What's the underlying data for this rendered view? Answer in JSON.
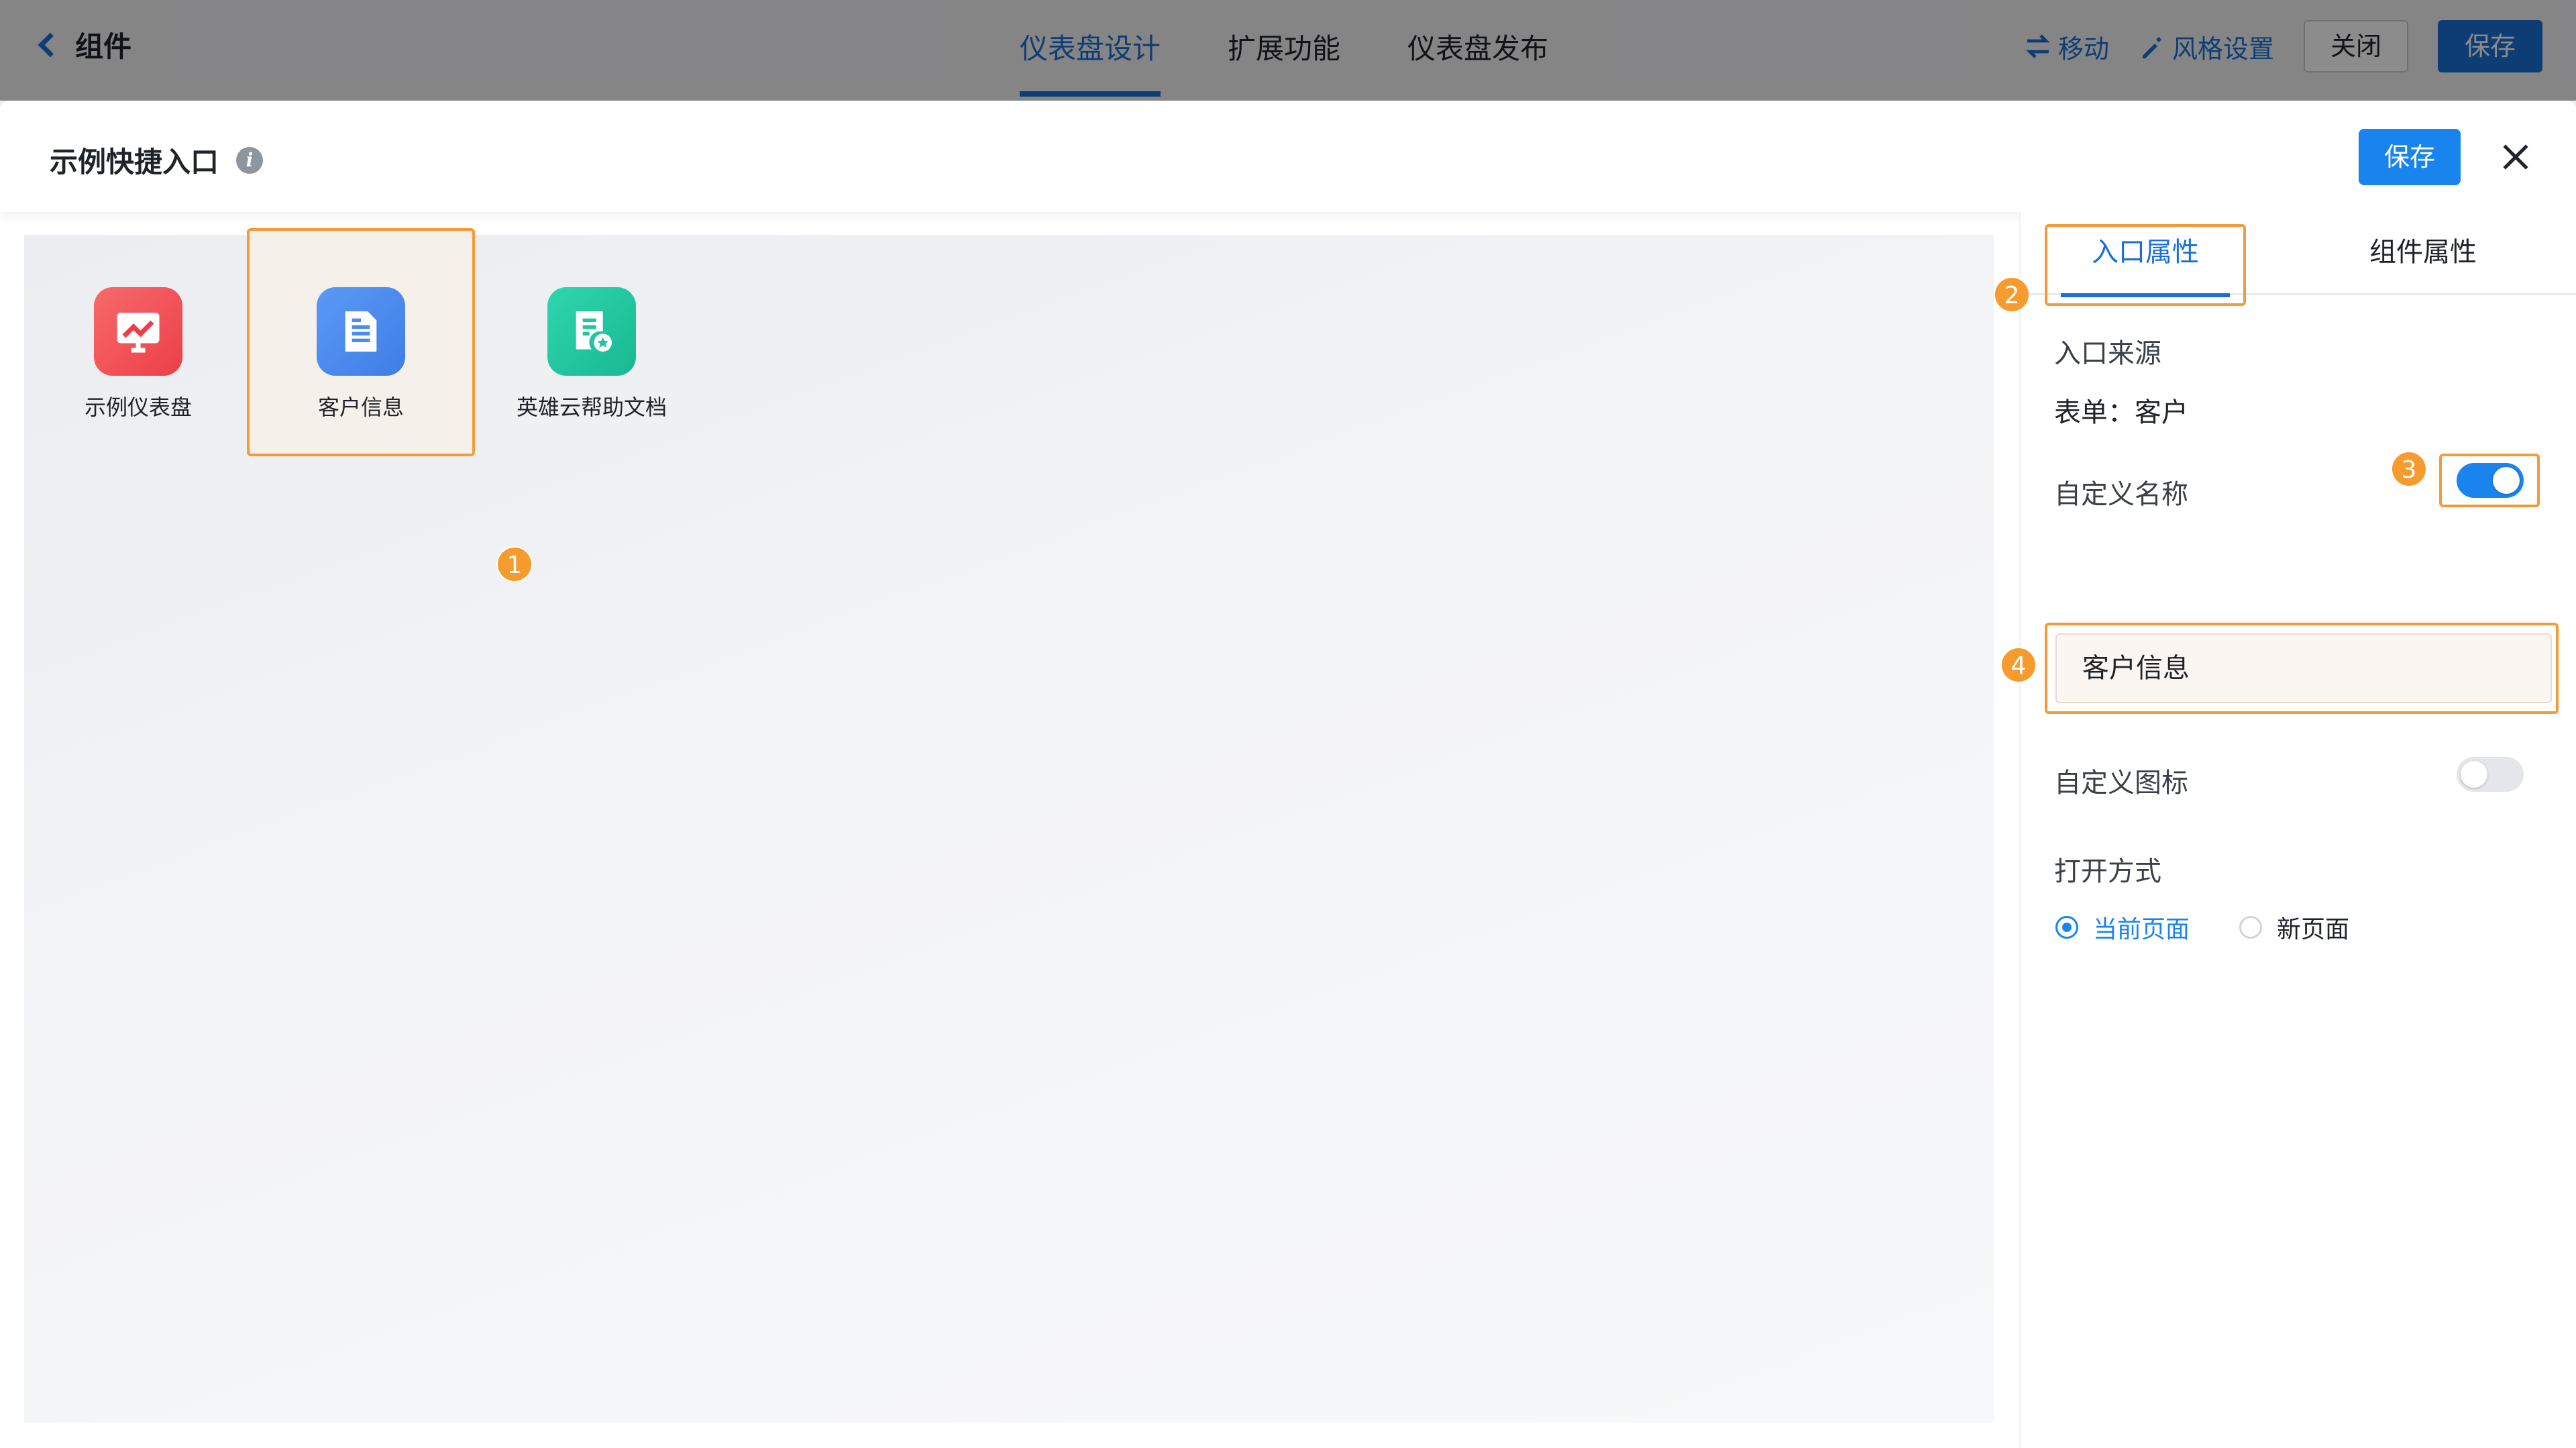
{
  "topbar": {
    "back_label": "组件",
    "tabs": [
      "仪表盘设计",
      "扩展功能",
      "仪表盘发布"
    ],
    "move_label": "移动",
    "style_label": "风格设置",
    "close_label": "关闭",
    "save_label": "保存"
  },
  "modal": {
    "title": "示例快捷入口",
    "info_glyph": "i",
    "save_label": "保存"
  },
  "tiles": [
    {
      "label": "示例仪表盘",
      "color": "#f0555b",
      "icon": "chart-trend-icon"
    },
    {
      "label": "客户信息",
      "color": "#4a8cf0",
      "icon": "document-icon",
      "selected": true
    },
    {
      "label": "英雄云帮助文档",
      "color": "#1fc7a0",
      "icon": "document-star-icon"
    }
  ],
  "badges": [
    "1",
    "2",
    "3",
    "4"
  ],
  "panel": {
    "tabs": [
      "入口属性",
      "组件属性"
    ],
    "source_label": "入口来源",
    "source_value": "表单：客户",
    "custom_name_label": "自定义名称",
    "custom_name_on": true,
    "custom_name_value": "客户信息",
    "custom_icon_label": "自定义图标",
    "custom_icon_on": false,
    "open_mode_label": "打开方式",
    "open_options": [
      "当前页面",
      "新页面"
    ],
    "open_selected": "当前页面"
  },
  "colors": {
    "accent": "#1a84ee",
    "highlight": "#f39b3a"
  }
}
